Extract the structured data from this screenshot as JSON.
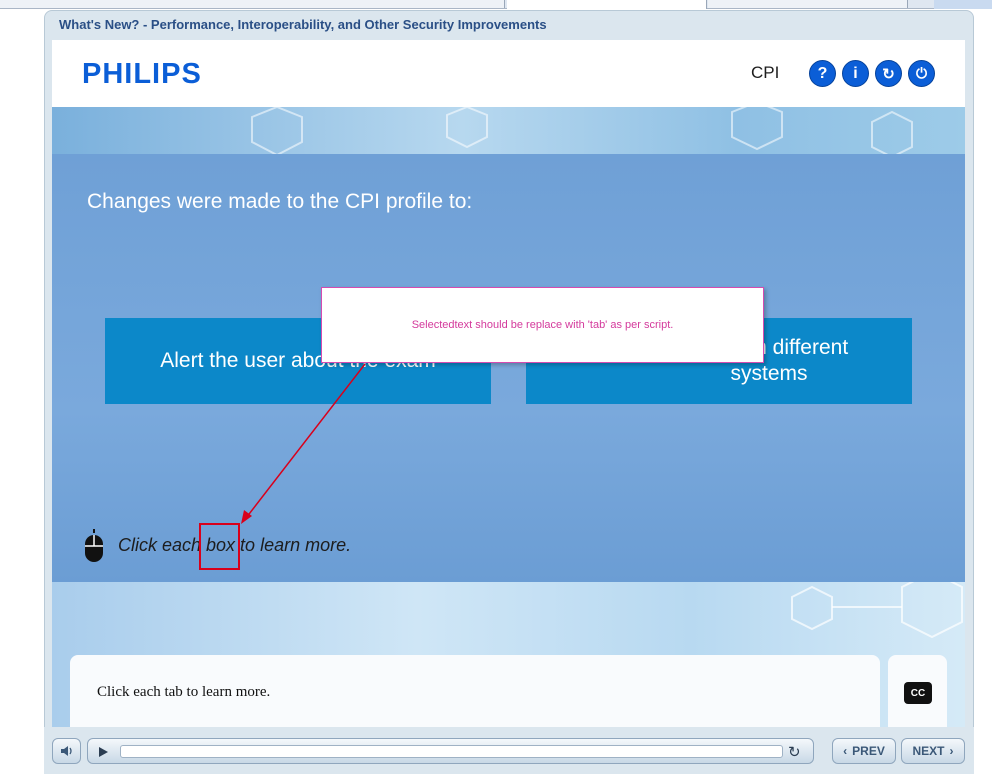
{
  "player": {
    "title": "What's New? - Performance, Interoperability, and Other Security Improvements"
  },
  "header": {
    "logo": "PHILIPS",
    "section_label": "CPI",
    "buttons": [
      {
        "icon": "help-icon",
        "glyph": "?"
      },
      {
        "icon": "info-icon",
        "glyph": "i"
      },
      {
        "icon": "refresh-icon",
        "glyph": "↻"
      },
      {
        "icon": "power-icon",
        "glyph": "⏻"
      }
    ]
  },
  "content": {
    "heading": "Changes were made to the CPI profile to:",
    "boxes": [
      {
        "label": "Alert the user about the exam"
      },
      {
        "label": "ata from different systems"
      }
    ],
    "instruction": "Click each box to learn more."
  },
  "annotation": {
    "note": "Selectedtext should be replace with 'tab' as per script."
  },
  "transcript": {
    "text": "Click each tab to learn more.",
    "cc_label": "CC"
  },
  "controls": {
    "prev_label": "PREV",
    "next_label": "NEXT"
  },
  "colors": {
    "brand_blue": "#0b5ed7",
    "box_blue": "#0c88c9",
    "annotation_pink": "#d43a9c",
    "highlight_red": "#d9001b"
  }
}
